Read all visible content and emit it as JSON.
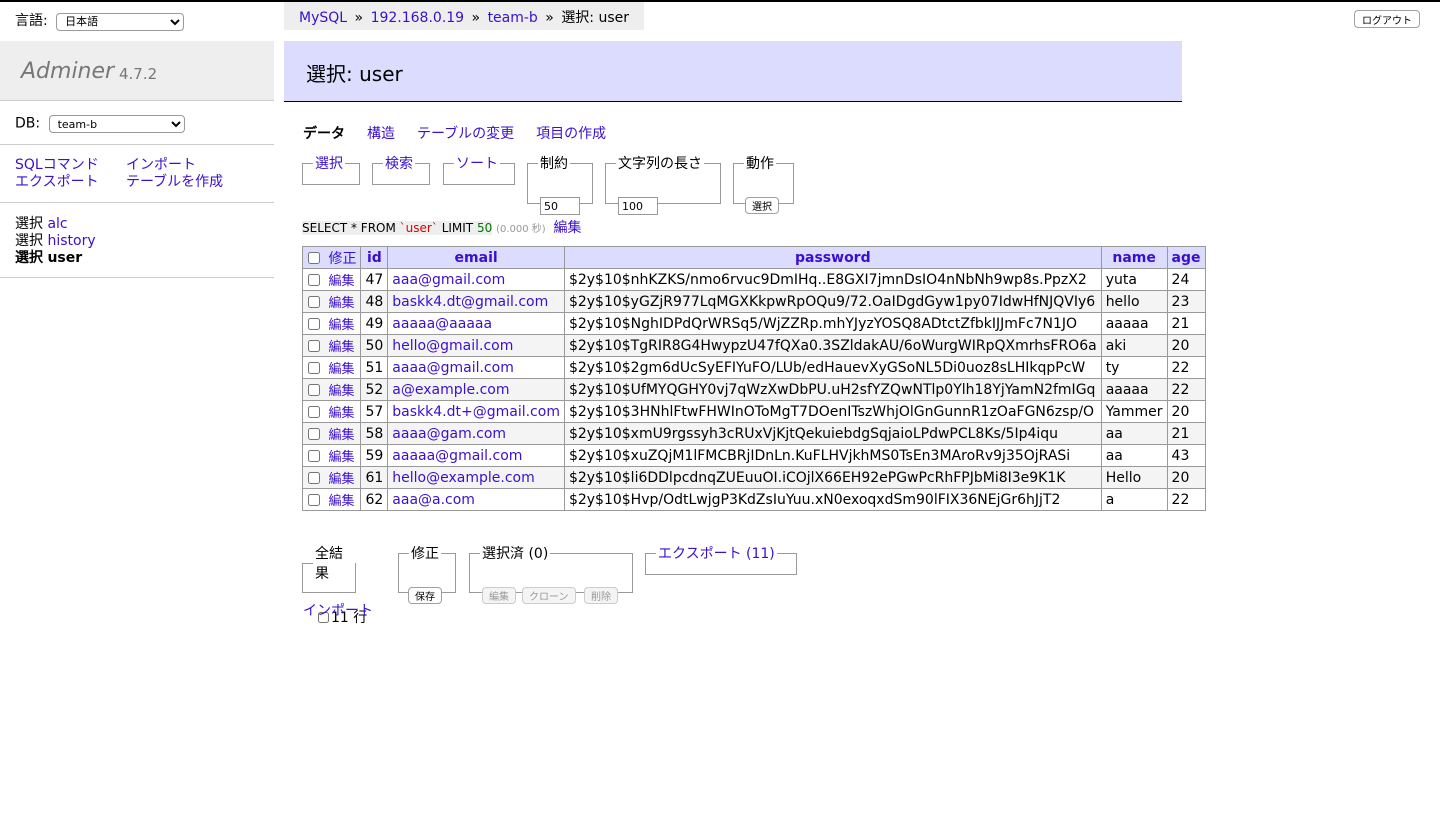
{
  "lang": {
    "label": "言語:",
    "selected": "日本語"
  },
  "brand": {
    "name": "Adminer",
    "version": "4.7.2"
  },
  "db": {
    "label": "DB:",
    "selected": "team-b"
  },
  "commands": {
    "sql": "SQLコマンド",
    "import": "インポート",
    "export": "エクスポート",
    "create_table": "テーブルを作成"
  },
  "tables": [
    {
      "prefix": "選択",
      "name": "alc"
    },
    {
      "prefix": "選択",
      "name": "history"
    },
    {
      "prefix": "選択",
      "name": "user"
    }
  ],
  "breadcrumb": {
    "mysql": "MySQL",
    "sep": "»",
    "host": "192.168.0.19",
    "db": "team-b",
    "current": "選択: user"
  },
  "logout": "ログアウト",
  "page_title": "選択: user",
  "tabs": {
    "data": "データ",
    "structure": "構造",
    "alter": "テーブルの変更",
    "new_item": "項目の作成"
  },
  "filters": {
    "select": "選択",
    "search": "検索",
    "sort": "ソート",
    "limit_label": "制約",
    "limit_value": "50",
    "textlen_label": "文字列の長さ",
    "textlen_value": "100",
    "action_label": "動作",
    "action_button": "選択"
  },
  "sql": {
    "keyword1": "SELECT * FROM",
    "table": "`user`",
    "keyword2": "LIMIT",
    "limit": "50",
    "time": "(0.000 秒)",
    "edit": "編集"
  },
  "grid": {
    "modify_header": "修正",
    "edit_label": "編集",
    "columns": [
      "id",
      "email",
      "password",
      "name",
      "age"
    ],
    "rows": [
      {
        "id": "47",
        "email": "aaa@gmail.com",
        "password": "$2y$10$nhKZKS/nmo6rvuc9DmIHq..E8GXI7jmnDsIO4nNbNh9wp8s.PpzX2",
        "name": "yuta",
        "age": "24"
      },
      {
        "id": "48",
        "email": "baskk4.dt@gmail.com",
        "password": "$2y$10$yGZjR977LqMGXKkpwRpOQu9/72.OaIDgdGyw1py07IdwHfNJQVIy6",
        "name": "hello",
        "age": "23"
      },
      {
        "id": "49",
        "email": "aaaaa@aaaaa",
        "password": "$2y$10$NghIDPdQrWRSq5/WjZZRp.mhYJyzYOSQ8ADtctZfbkIJJmFc7N1JO",
        "name": "aaaaa",
        "age": "21"
      },
      {
        "id": "50",
        "email": "hello@gmail.com",
        "password": "$2y$10$TgRIR8G4HwypzU47fQXa0.3SZldakAU/6oWurgWIRpQXmrhsFRO6a",
        "name": "aki",
        "age": "20"
      },
      {
        "id": "51",
        "email": "aaaa@gmail.com",
        "password": "$2y$10$2gm6dUcSyEFIYuFO/LUb/edHauevXyGSoNL5Di0uoz8sLHIkqpPcW",
        "name": "ty",
        "age": "22"
      },
      {
        "id": "52",
        "email": "a@example.com",
        "password": "$2y$10$UfMYQGHY0vj7qWzXwDbPU.uH2sfYZQwNTlp0Ylh18YjYamN2fmIGq",
        "name": "aaaaa",
        "age": "22"
      },
      {
        "id": "57",
        "email": "baskk4.dt+@gmail.com",
        "password": "$2y$10$3HNhlFtwFHWInOToMgT7DOenITszWhjOlGnGunnR1zOaFGN6zsp/O",
        "name": "Yammer",
        "age": "20"
      },
      {
        "id": "58",
        "email": "aaaa@gam.com",
        "password": "$2y$10$xmU9rgssyh3cRUxVjKjtQekuiebdgSqjaioLPdwPCL8Ks/5Ip4iqu",
        "name": "aa",
        "age": "21"
      },
      {
        "id": "59",
        "email": "aaaaa@gmail.com",
        "password": "$2y$10$xuZQjM1lFMCBRjIDnLn.KuFLHVjkhMS0TsEn3MAroRv9j35OjRASi",
        "name": "aa",
        "age": "43"
      },
      {
        "id": "61",
        "email": "hello@example.com",
        "password": "$2y$10$li6DDlpcdnqZUEuuOI.iCOjlX66EH92ePGwPcRhFPJbMi8I3e9K1K",
        "name": "Hello",
        "age": "20"
      },
      {
        "id": "62",
        "email": "aaa@a.com",
        "password": "$2y$10$Hvp/OdtLwjgP3KdZsIuYuu.xN0exoqxdSm90lFIX36NEjGr6hJjT2",
        "name": "a",
        "age": "22"
      }
    ]
  },
  "bottom": {
    "all_results": "全結果",
    "row_count": "11 行",
    "modify": "修正",
    "save": "保存",
    "selected": "選択済 (0)",
    "edit": "編集",
    "clone": "クローン",
    "delete": "削除",
    "export": "エクスポート (11)",
    "import": "インポート"
  }
}
